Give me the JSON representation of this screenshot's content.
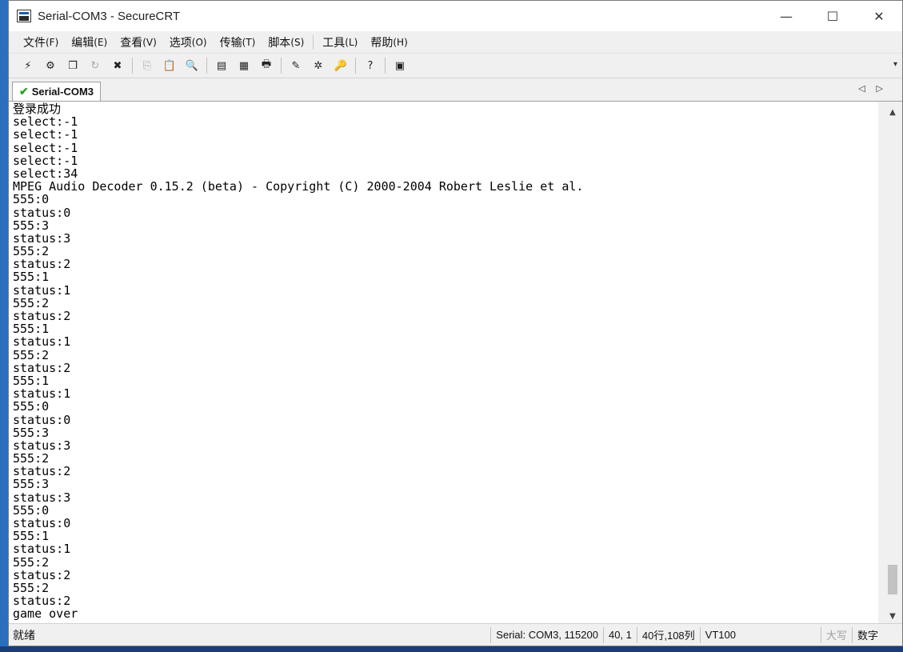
{
  "window": {
    "title": "Serial-COM3 - SecureCRT",
    "minimize": "—",
    "maximize": "☐",
    "close": "✕"
  },
  "menu": {
    "items": [
      {
        "label": "文件",
        "accel": "(F)"
      },
      {
        "label": "编辑",
        "accel": "(E)"
      },
      {
        "label": "查看",
        "accel": "(V)"
      },
      {
        "label": "选项",
        "accel": "(O)"
      },
      {
        "label": "传输",
        "accel": "(T)"
      },
      {
        "label": "脚本",
        "accel": "(S)"
      },
      {
        "label": "工具",
        "accel": "(L)"
      },
      {
        "label": "帮助",
        "accel": "(H)"
      }
    ]
  },
  "toolbar": {
    "icons": [
      {
        "name": "connect-icon",
        "glyph": "⚡"
      },
      {
        "name": "quick-connect-icon",
        "glyph": "⚙"
      },
      {
        "name": "connect-tab-icon",
        "glyph": "❐"
      },
      {
        "name": "reconnect-icon",
        "glyph": "↻"
      },
      {
        "name": "disconnect-icon",
        "glyph": "✖"
      },
      {
        "name": "copy-icon",
        "glyph": "⎘"
      },
      {
        "name": "paste-icon",
        "glyph": "📋"
      },
      {
        "name": "find-icon",
        "glyph": "🔍"
      },
      {
        "name": "print-screen-icon",
        "glyph": "▤"
      },
      {
        "name": "print-selection-icon",
        "glyph": "▦"
      },
      {
        "name": "print-icon",
        "glyph": "🖶"
      },
      {
        "name": "session-options-icon",
        "glyph": "✎"
      },
      {
        "name": "global-options-icon",
        "glyph": "✲"
      },
      {
        "name": "keymap-icon",
        "glyph": "🔑"
      },
      {
        "name": "help-icon",
        "glyph": "?"
      },
      {
        "name": "tile-icon",
        "glyph": "▣"
      }
    ]
  },
  "tab": {
    "label": "Serial-COM3",
    "arrows": "◁▷"
  },
  "terminal": {
    "lines": [
      "登录成功",
      "select:-1",
      "select:-1",
      "select:-1",
      "select:-1",
      "select:34",
      "MPEG Audio Decoder 0.15.2 (beta) - Copyright (C) 2000-2004 Robert Leslie et al.",
      "555:0",
      "status:0",
      "555:3",
      "status:3",
      "555:2",
      "status:2",
      "555:1",
      "status:1",
      "555:2",
      "status:2",
      "555:1",
      "status:1",
      "555:2",
      "status:2",
      "555:1",
      "status:1",
      "555:0",
      "status:0",
      "555:3",
      "status:3",
      "555:2",
      "status:2",
      "555:3",
      "status:3",
      "555:0",
      "status:0",
      "555:1",
      "status:1",
      "555:2",
      "status:2",
      "555:2",
      "status:2",
      "game over"
    ]
  },
  "scrollbar": {
    "up": "▲",
    "down": "▼",
    "thumb_start": 0.91,
    "thumb_end": 0.97
  },
  "status": {
    "ready": "就绪",
    "connection": "Serial: COM3, 115200",
    "cursor": "40,   1",
    "size": "40行,108列",
    "emulation": "VT100",
    "caps": "大写",
    "num": "数字"
  }
}
